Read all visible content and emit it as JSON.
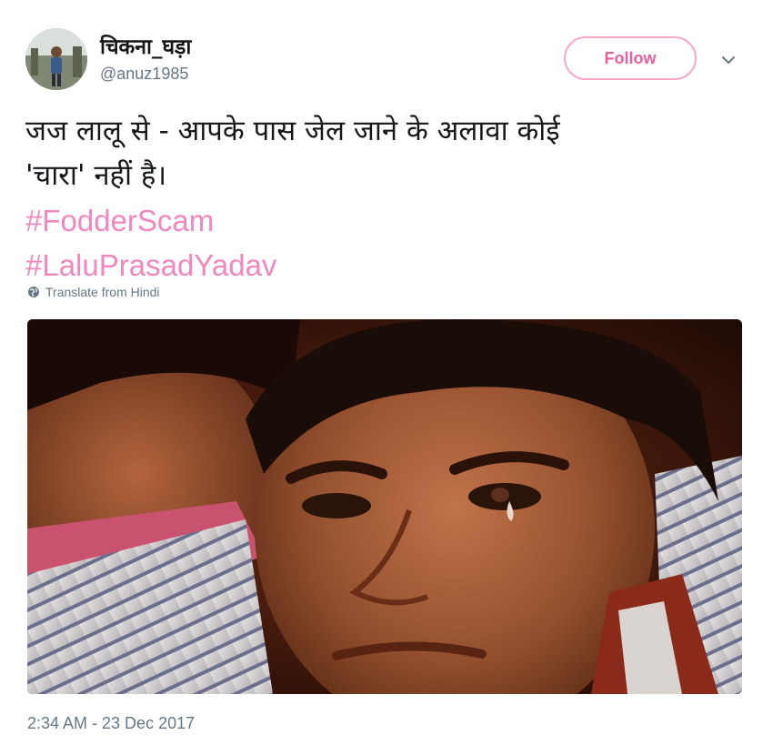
{
  "user": {
    "display_name": "चिकना_घड़ा",
    "handle": "@anuz1985"
  },
  "follow_button": {
    "label": "Follow"
  },
  "tweet": {
    "text_lines": [
      "जज लालू से - आपके पास जेल जाने के अलावा कोई",
      "'चारा' नहीं है।"
    ],
    "hashtags": [
      "#FodderScam",
      "#LaluPrasadYadav"
    ],
    "translate_label": "Translate from Hindi",
    "timestamp": "2:34 AM - 23 Dec 2017"
  },
  "colors": {
    "accent": "#e8609b",
    "hashtag": "#f087bd",
    "muted": "#657786"
  },
  "icons": {
    "menu": "chevron-down-icon",
    "translate": "globe-icon"
  }
}
